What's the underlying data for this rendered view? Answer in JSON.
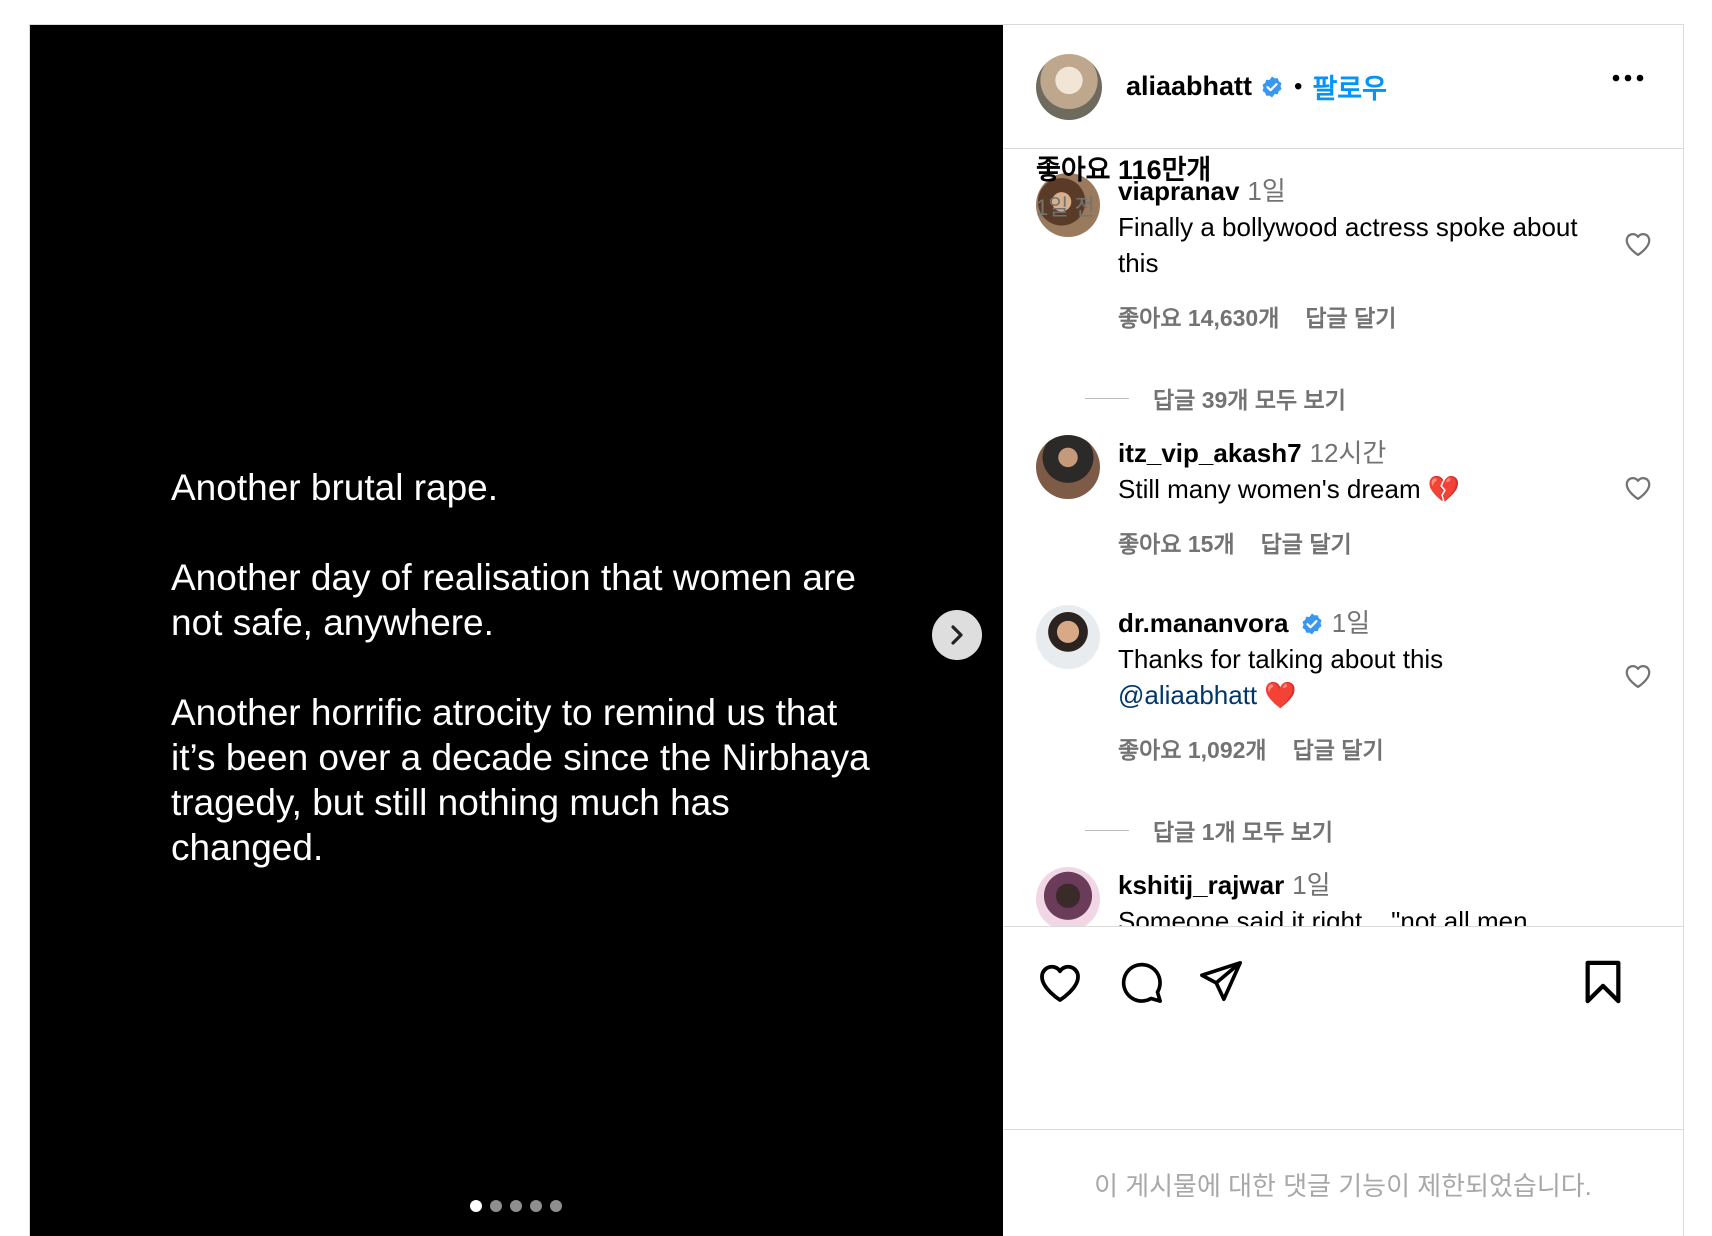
{
  "post": {
    "caption_paragraphs": [
      "Another brutal rape.",
      "Another day of realisation that women are not safe, anywhere.",
      "Another horrific atrocity to remind us that it’s been over a decade since the Nirbhaya tragedy, but still nothing much has changed."
    ],
    "carousel": {
      "total": 5,
      "active_index": 0
    }
  },
  "header": {
    "username": "aliaabhatt",
    "separator": "•",
    "follow_label": "팔로우"
  },
  "comments": [
    {
      "username": "viapranav",
      "time": "1일",
      "text": "Finally a bollywood actress spoke about this",
      "likes": "좋아요 14,630개",
      "reply_label": "답글 달기",
      "view_replies": "답글 39개 모두 보기"
    },
    {
      "username": "itz_vip_akash7",
      "time": "12시간",
      "text": "Still many women's dream 💔",
      "likes": "좋아요 15개",
      "reply_label": "답글 달기"
    },
    {
      "username": "dr.mananvora",
      "time": "1일",
      "text": "Thanks for talking about this",
      "mention": "@aliaabhatt",
      "emoji": "❤️",
      "likes": "좋아요 1,092개",
      "reply_label": "답글 달기",
      "view_replies": "답글 1개 모두 보기"
    },
    {
      "username": "kshitij_rajwar",
      "time": "1일",
      "text": "Someone said it right... \"not all men..."
    }
  ],
  "footer": {
    "likes_total": "좋아요 116만개",
    "posted_ago": "1일 전",
    "comments_restricted": "이 게시물에 대한 댓글 기능이 제한되었습니다."
  },
  "icons": {
    "verified": "verified-badge-icon",
    "more": "more-options-icon",
    "next": "chevron-right-icon",
    "comment_like": "heart-outline-icon",
    "like": "heart-icon",
    "comment": "comment-bubble-icon",
    "share": "send-icon",
    "save": "bookmark-icon"
  },
  "colors": {
    "link_blue": "#0095f6",
    "mention": "#00376b",
    "muted": "#737373",
    "verified": "#3897f0",
    "border": "#dbdbdb"
  }
}
